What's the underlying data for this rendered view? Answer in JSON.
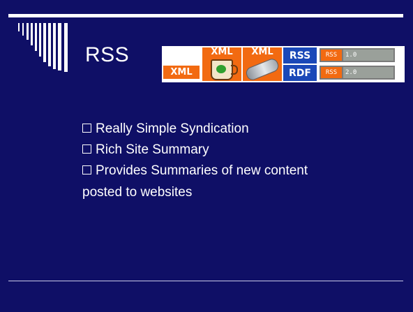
{
  "slide": {
    "title": "RSS",
    "badges": {
      "xml_small": "XML",
      "xml_mug": "XML",
      "xml_pill": "XML",
      "rss": "RSS",
      "rdf": "RDF",
      "version_rows": [
        {
          "tag": "RSS",
          "version": "1.0"
        },
        {
          "tag": "RSS",
          "version": "2.0"
        }
      ]
    },
    "bullets": [
      "Really Simple Syndication",
      "Rich Site Summary",
      "Provides Summaries of new content"
    ],
    "continuation": "posted to websites"
  },
  "colors": {
    "background": "#0f0f66",
    "text": "#ffffff",
    "rule": "#ffffff",
    "badge_orange": "#f26a11",
    "badge_blue": "#1a48b8"
  }
}
